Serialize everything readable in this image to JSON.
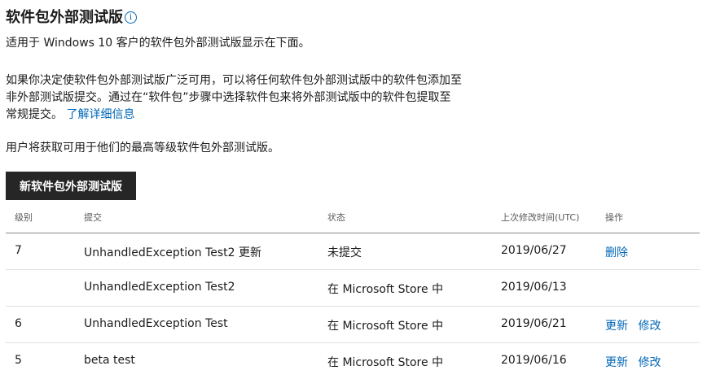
{
  "header": {
    "title": "软件包外部测试版",
    "info_icon": "i"
  },
  "intro": {
    "line1": "适用于 Windows 10 客户的软件包外部测试版显示在下面。",
    "line2a": "如果你决定使软件包外部测试版广泛可用，可以将任何软件包外部测试版中的软件包添加至非外部测试版提交。通过在“软件包”步骤中选择软件包来将外部测试版中的软件包提取至常规提交。",
    "learn_more": "了解详细信息",
    "line3": "用户将获取可用于他们的最高等级软件包外部测试版。"
  },
  "toolbar": {
    "new_button": "新软件包外部测试版"
  },
  "table": {
    "headers": {
      "level": "级别",
      "submission": "提交",
      "status": "状态",
      "modified": "上次修改时间(UTC)",
      "actions": "操作"
    },
    "rows": [
      {
        "level": "7",
        "submission": "UnhandledException Test2 更新",
        "status": "未提交",
        "modified": "2019/06/27",
        "action1": "删除",
        "action2": ""
      },
      {
        "level": "",
        "submission": "UnhandledException Test2",
        "status": "在 Microsoft Store 中",
        "modified": "2019/06/13",
        "action1": "",
        "action2": ""
      },
      {
        "level": "6",
        "submission": "UnhandledException Test",
        "status": "在 Microsoft Store 中",
        "modified": "2019/06/21",
        "action1": "更新",
        "action2": "修改"
      },
      {
        "level": "5",
        "submission": "beta test",
        "status": "在 Microsoft Store 中",
        "modified": "2019/06/16",
        "action1": "更新",
        "action2": "修改"
      }
    ]
  },
  "colors": {
    "link": "#0067b8",
    "button_bg": "#262626",
    "text": "#1b1b1b"
  }
}
